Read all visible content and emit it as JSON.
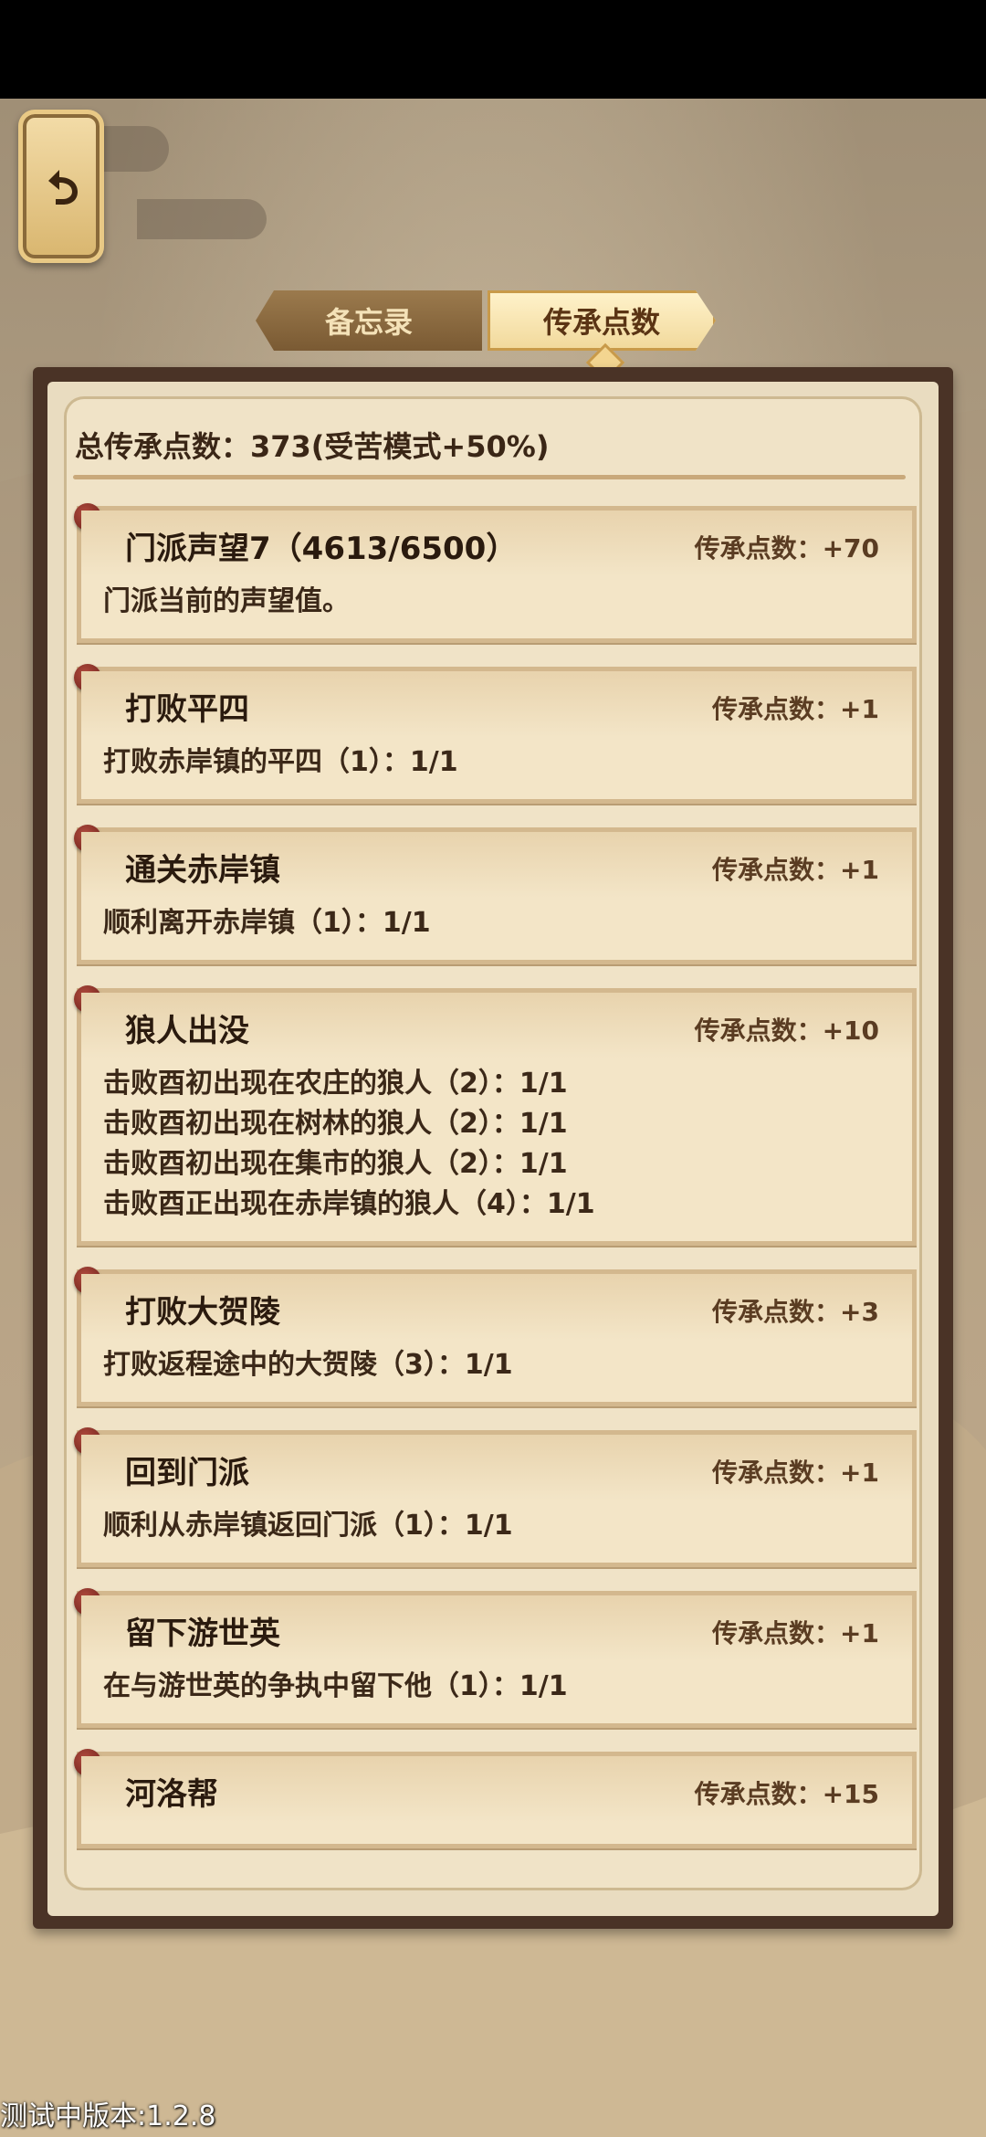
{
  "tabs": [
    {
      "label": "备忘录",
      "active": false
    },
    {
      "label": "传承点数",
      "active": true
    }
  ],
  "total_line": "总传承点数：373(受苦模式+50%)",
  "entries": [
    {
      "title": "门派声望7（4613/6500）",
      "points": "传承点数：+70",
      "lines": [
        "门派当前的声望值。"
      ]
    },
    {
      "title": "打败平四",
      "points": "传承点数：+1",
      "lines": [
        "打败赤岸镇的平四（1）：1/1"
      ]
    },
    {
      "title": "通关赤岸镇",
      "points": "传承点数：+1",
      "lines": [
        "顺利离开赤岸镇（1）：1/1"
      ]
    },
    {
      "title": "狼人出没",
      "points": "传承点数：+10",
      "lines": [
        "击败酉初出现在农庄的狼人（2）：1/1",
        "击败酉初出现在树林的狼人（2）：1/1",
        "击败酉初出现在集市的狼人（2）：1/1",
        "击败酉正出现在赤岸镇的狼人（4）：1/1"
      ]
    },
    {
      "title": "打败大贺陵",
      "points": "传承点数：+3",
      "lines": [
        "打败返程途中的大贺陵（3）：1/1"
      ]
    },
    {
      "title": "回到门派",
      "points": "传承点数：+1",
      "lines": [
        "顺利从赤岸镇返回门派（1）：1/1"
      ]
    },
    {
      "title": "留下游世英",
      "points": "传承点数：+1",
      "lines": [
        "在与游世英的争执中留下他（1）：1/1"
      ]
    },
    {
      "title": "河洛帮",
      "points": "传承点数：+15",
      "lines": []
    }
  ],
  "version_text": "测试中版本:1.2.8",
  "icons": {
    "back": "back-arrow-icon",
    "pin": "pin-icon"
  }
}
